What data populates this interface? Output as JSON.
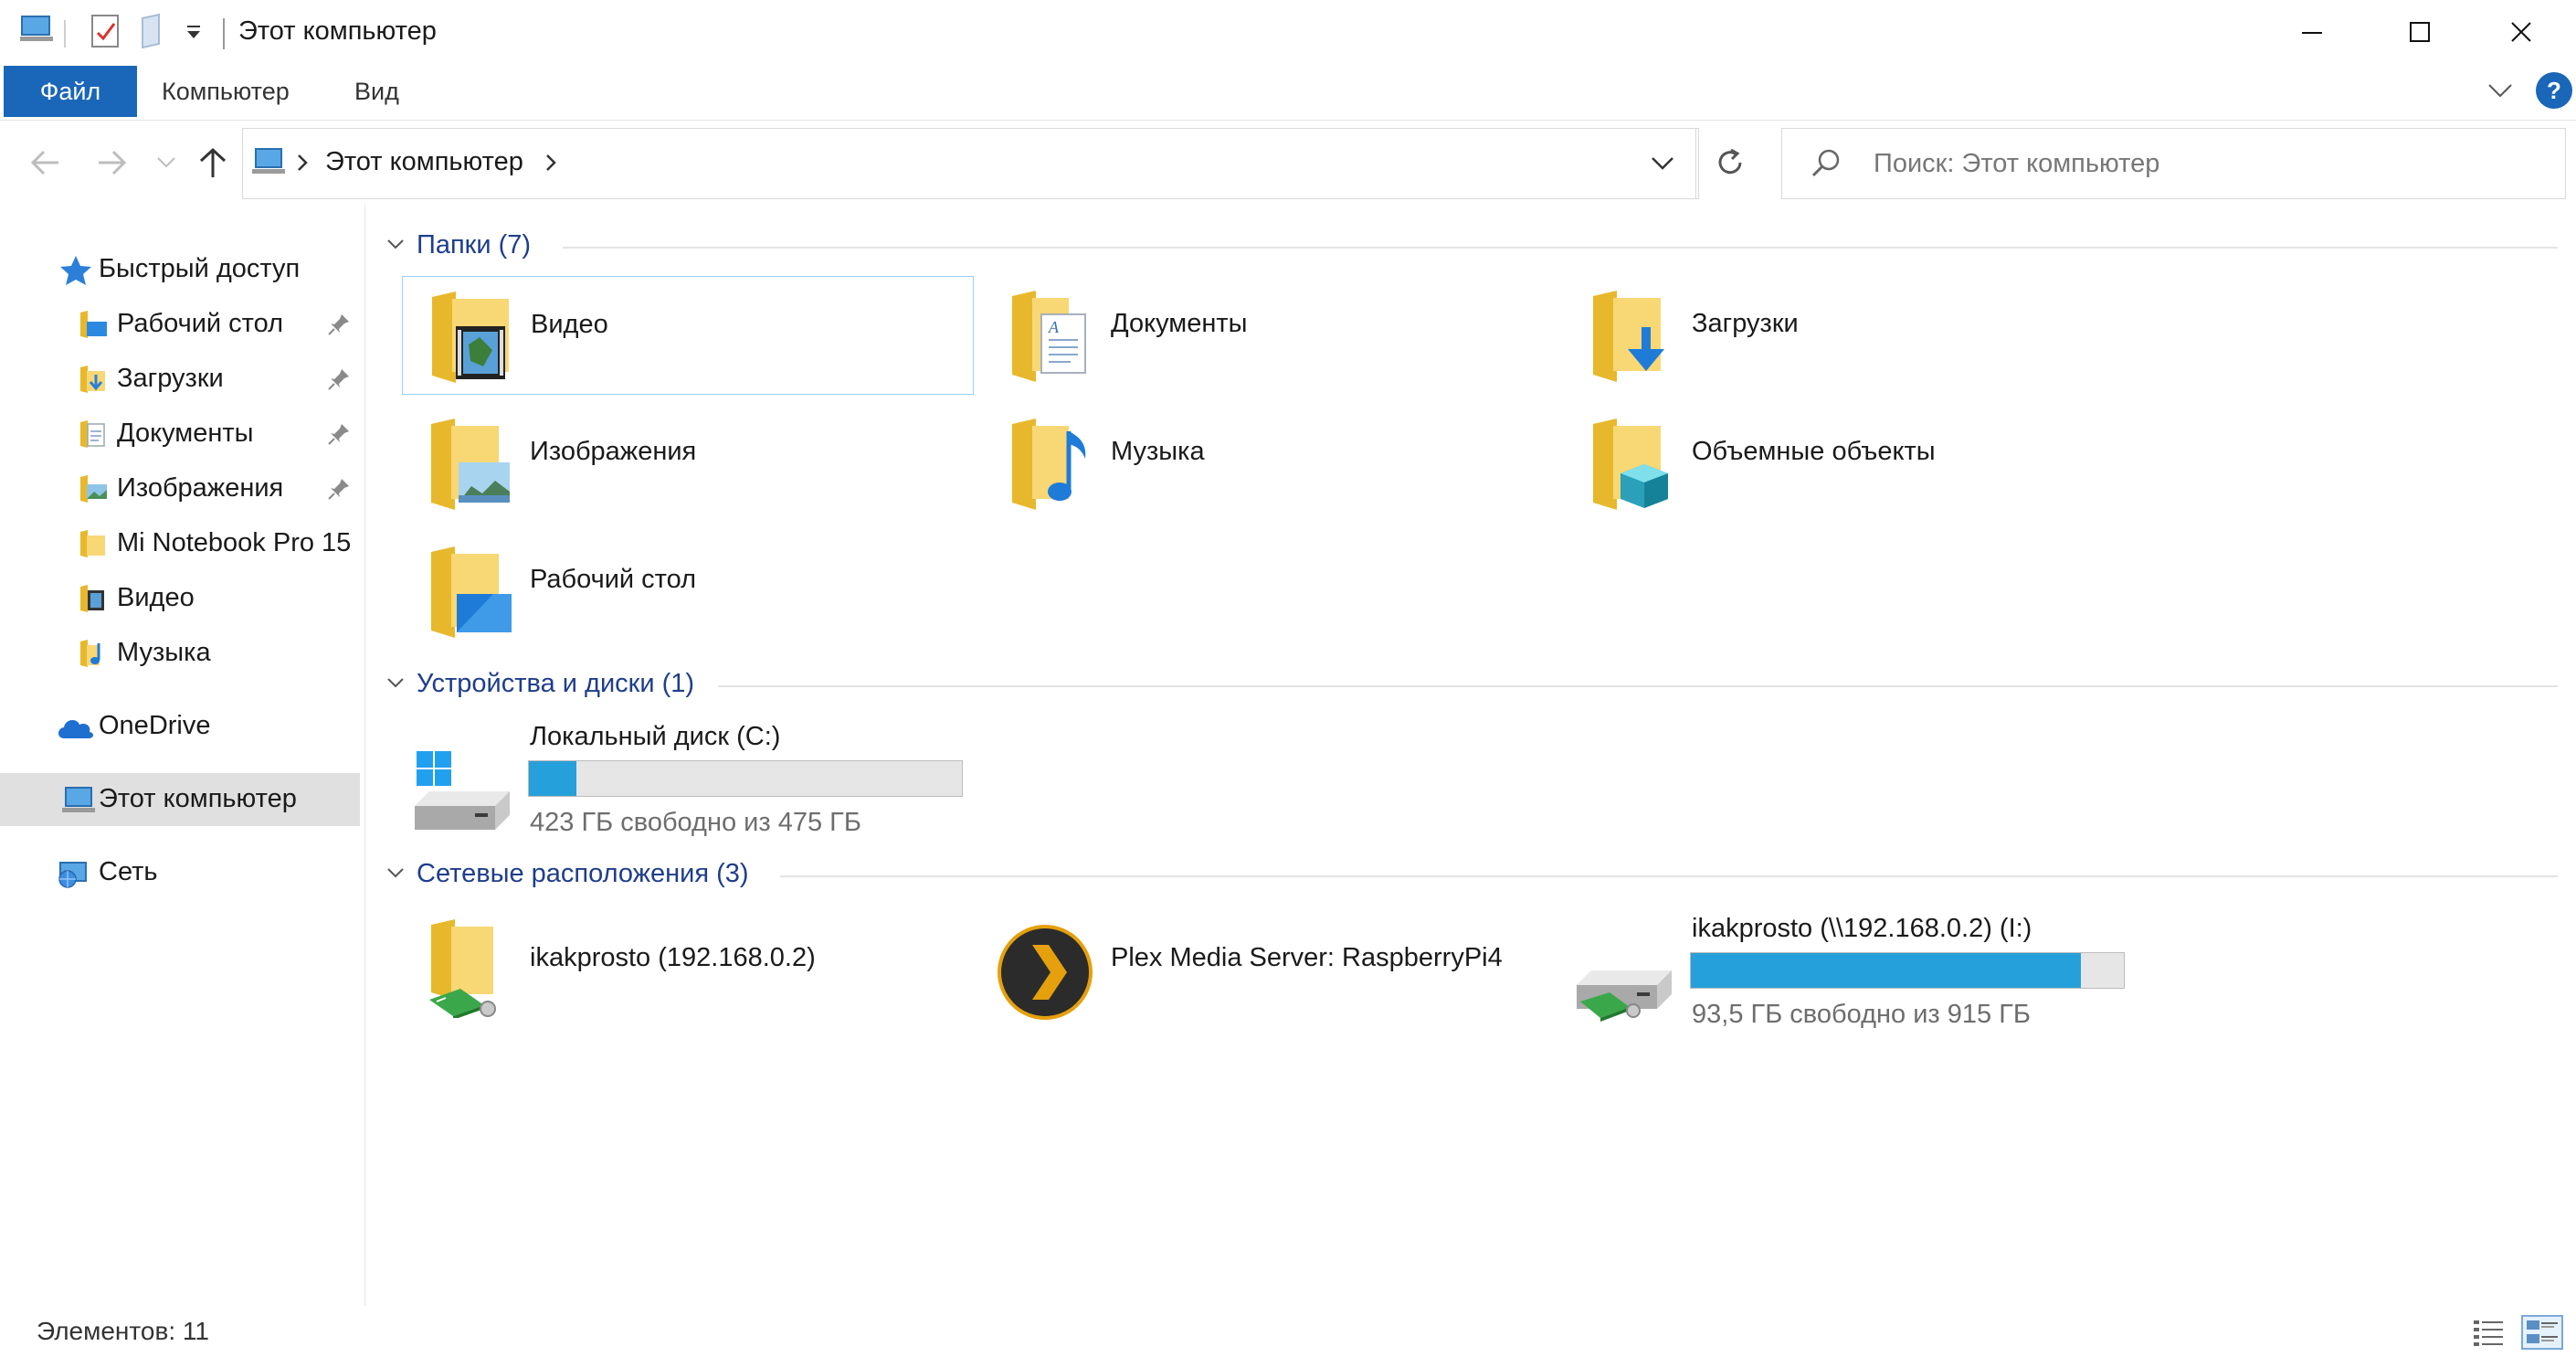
{
  "window": {
    "title": "Этот компьютер"
  },
  "ribbon": {
    "tabs": [
      "Файл",
      "Компьютер",
      "Вид"
    ],
    "help_label": "?"
  },
  "address": {
    "path": "Этот компьютер",
    "search_placeholder": "Поиск: Этот компьютер"
  },
  "navpane": {
    "quick_access": "Быстрый доступ",
    "quick_items": [
      "Рабочий стол",
      "Загрузки",
      "Документы",
      "Изображения",
      "Mi Notebook Pro 15",
      "Видео",
      "Музыка"
    ],
    "onedrive": "OneDrive",
    "this_pc": "Этот компьютер",
    "network": "Сеть"
  },
  "groups": {
    "folders": {
      "header": "Папки (7)",
      "items": [
        "Видео",
        "Документы",
        "Загрузки",
        "Изображения",
        "Музыка",
        "Объемные объекты",
        "Рабочий стол"
      ]
    },
    "devices": {
      "header": "Устройства и диски (1)",
      "drives": [
        {
          "name": "Локальный диск (C:)",
          "free_text": "423 ГБ свободно из 475 ГБ",
          "used_fraction": 0.11
        }
      ]
    },
    "network": {
      "header": "Сетевые расположения (3)",
      "items": [
        "ikakprosto (192.168.0.2)",
        "Plex Media Server: RaspberryPi4"
      ],
      "drives": [
        {
          "name": "ikakprosto (\\\\192.168.0.2) (I:)",
          "free_text": "93,5 ГБ свободно из 915 ГБ",
          "used_fraction": 0.9
        }
      ]
    }
  },
  "status": {
    "item_count": "Элементов: 11"
  },
  "colors": {
    "accent": "#1a66b8",
    "group_header": "#1e3d8c",
    "bar_fill": "#26a0da",
    "folder": "#f8d775"
  }
}
